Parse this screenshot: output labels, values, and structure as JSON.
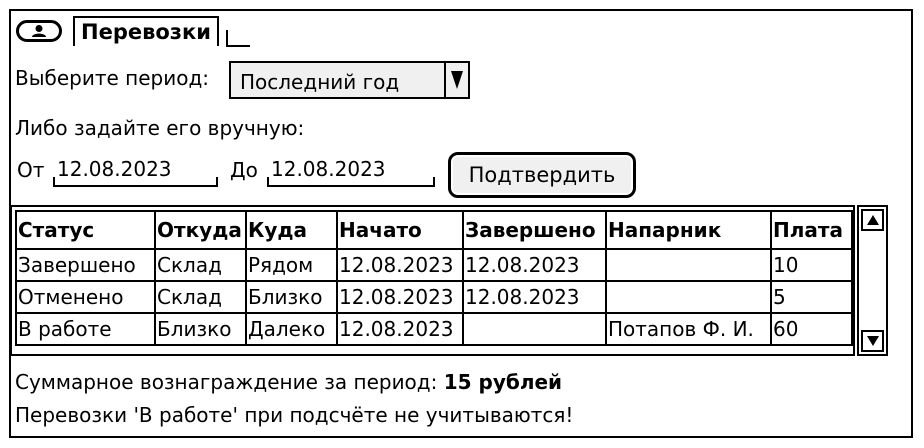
{
  "tab": {
    "label": "Перевозки",
    "icon": "user-icon"
  },
  "period": {
    "label": "Выберите период:",
    "selected": "Последний год"
  },
  "manual_hint": "Либо задайте его вручную:",
  "from": {
    "label": "От",
    "value": "12.08.2023"
  },
  "to": {
    "label": "До",
    "value": "12.08.2023"
  },
  "confirm_button": "Подтвердить",
  "table": {
    "columns": [
      "Статус",
      "Откуда",
      "Куда",
      "Начато",
      "Завершено",
      "Напарник",
      "Плата"
    ],
    "rows": [
      [
        "Завершено",
        "Склад",
        "Рядом",
        "12.08.2023",
        "12.08.2023",
        "",
        "10"
      ],
      [
        "Отменено",
        "Склад",
        "Близко",
        "12.08.2023",
        "12.08.2023",
        "",
        "5"
      ],
      [
        "В работе",
        "Близко",
        "Далеко",
        "12.08.2023",
        "",
        "Потапов Ф. И.",
        "60"
      ]
    ]
  },
  "summary": {
    "label": "Суммарное вознаграждение за период:",
    "value": "15 рублей"
  },
  "note": "Перевозки 'В работе' при подсчёте не учитываются!"
}
